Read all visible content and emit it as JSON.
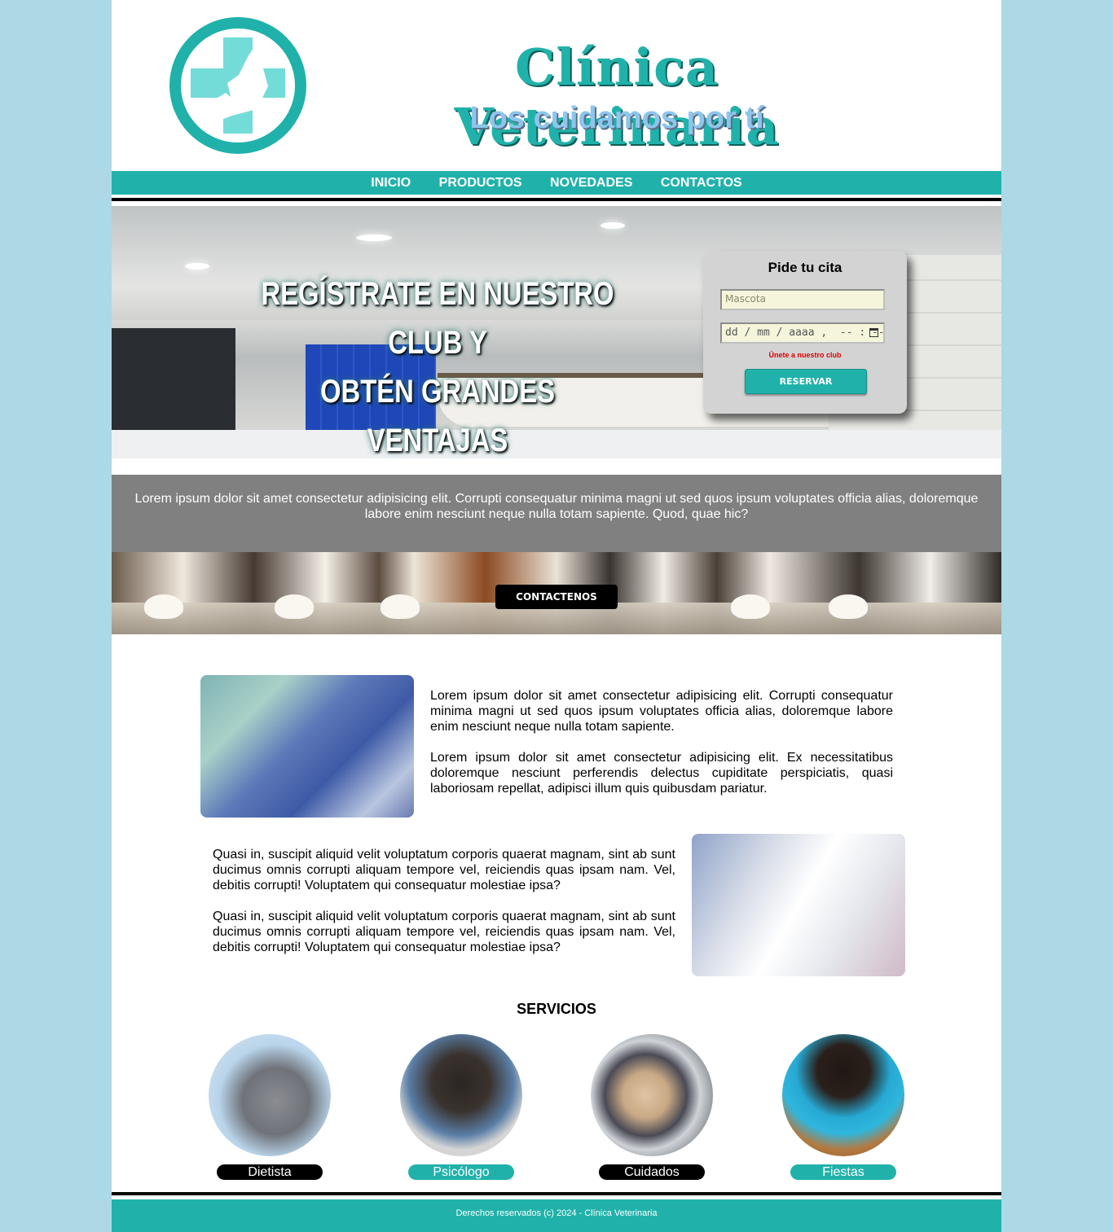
{
  "header": {
    "logo_icon": "vet-cross-logo-icon",
    "title": "Clínica Veterinaria",
    "subtitle": "Los cuidamos por tí"
  },
  "nav": {
    "items": [
      "INICIO",
      "PRODUCTOS",
      "NOVEDADES",
      "CONTACTOS"
    ]
  },
  "hero": {
    "headline_line1": "REGÍSTRATE EN NUESTRO CLUB Y",
    "headline_line2": "OBTÉN GRANDES VENTAJAS",
    "booking": {
      "title": "Pide tu cita",
      "pet_placeholder": "Mascota",
      "datetime_placeholder": "dd / mm / aaaa ,  -- : --",
      "club_link": "Únete a nuestro club",
      "submit_label": "RESERVAR"
    }
  },
  "band": {
    "text": "Lorem ipsum dolor sit amet consectetur adipisicing elit. Corrupti consequatur minima magni ut sed quos ipsum voluptates officia alias, doloremque labore enim nesciunt neque nulla totam sapiente. Quod, quae hic?"
  },
  "cta": {
    "label": "CONTACTENOS"
  },
  "articles": {
    "p1": "Lorem ipsum dolor sit amet consectetur adipisicing elit. Corrupti consequatur minima magni ut sed quos ipsum voluptates officia alias, doloremque labore enim nesciunt neque nulla totam sapiente.",
    "p2": "Lorem ipsum dolor sit amet consectetur adipisicing elit. Ex necessitatibus doloremque nesciunt perferendis delectus cupiditate perspiciatis, quasi laboriosam repellat, adipisci illum quis quibusdam pariatur.",
    "p3": "Quasi in, suscipit aliquid velit voluptatum corporis quaerat magnam, sint ab sunt ducimus omnis corrupti aliquam tempore vel, reiciendis quas ipsam nam. Vel, debitis corrupti! Voluptatem qui consequatur molestiae ipsa?",
    "p4": "Quasi in, suscipit aliquid velit voluptatum corporis quaerat magnam, sint ab sunt ducimus omnis corrupti aliquam tempore vel, reiciendis quas ipsam nam. Vel, debitis corrupti! Voluptatem qui consequatur molestiae ipsa?"
  },
  "services": {
    "title": "SERVICIOS",
    "items": [
      {
        "label": "Dietista",
        "image": "gray-cat-photo"
      },
      {
        "label": "Psicólogo",
        "image": "pug-photo"
      },
      {
        "label": "Cuidados",
        "image": "french-bulldog-photo"
      },
      {
        "label": "Fiestas",
        "image": "puppy-thank-you-photo"
      }
    ]
  },
  "footer": {
    "text": "Derechos reservados (c) 2024 - Clínica Veterinaria"
  },
  "colors": {
    "background": "#add8e6",
    "accent": "#20b2aa",
    "band": "#808080",
    "input_bg": "#f5f5dc",
    "alert": "#e00000"
  }
}
